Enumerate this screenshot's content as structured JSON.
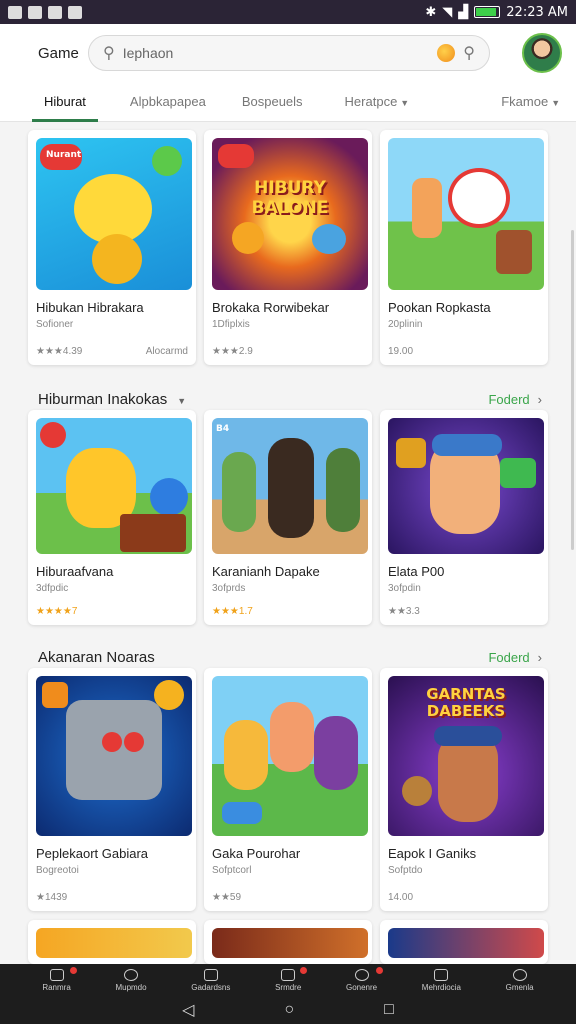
{
  "status": {
    "time": "22:23 AM",
    "battery_level": 0.9
  },
  "header": {
    "brand": "Game",
    "search_value": "Iephaon"
  },
  "tabs": [
    {
      "label": "Hiburat",
      "active": true
    },
    {
      "label": "Alpbkapapea"
    },
    {
      "label": "Bospeuels"
    },
    {
      "label": "Heratpce"
    },
    {
      "label": "Fkamoe"
    }
  ],
  "sections": [
    {
      "title": "",
      "cards": [
        {
          "title": "Hibukan Hibrakara",
          "sub": "Sofioner",
          "meta_left": "★★★4.39",
          "meta_right": "Alocarmd"
        },
        {
          "title": "Brokaka Rorwibekar",
          "sub": "1Dfiplxis",
          "meta_left": "★★★2.9",
          "meta_right": ""
        },
        {
          "title": "Pookan Ropkasta",
          "sub": "20plinin",
          "meta_left": "19.00",
          "meta_right": ""
        }
      ]
    },
    {
      "title": "Hiburman Inakokas",
      "featured": "Foderd",
      "cards": [
        {
          "title": "Hiburaafvana",
          "sub": "3dfpdic",
          "meta_left": "★★★★7",
          "meta_right": ""
        },
        {
          "title": "Karanianh Dapake",
          "sub": "3ofprds",
          "meta_left": "★★★1.7",
          "meta_right": ""
        },
        {
          "title": "Elata P00",
          "sub": "3ofpdin",
          "meta_left": "★★3.3",
          "meta_right": ""
        }
      ]
    },
    {
      "title": "Akanaran Noaras",
      "featured": "Foderd",
      "cards": [
        {
          "title": "Peplekaort Gabiara",
          "sub": "Bogreotoi",
          "meta_left": "★1439",
          "meta_right": ""
        },
        {
          "title": "Gaka Pourohar",
          "sub": "Sofptcorl",
          "meta_left": "★★59",
          "meta_right": ""
        },
        {
          "title": "Eapok I Ganiks",
          "sub": "Sofptdo",
          "meta_left": "14.00",
          "meta_right": ""
        }
      ]
    }
  ],
  "thumb_labels": {
    "badge1": "Nurant",
    "card2": "HIBURY BALONE",
    "card9": "GARNTAS DABEEKS",
    "badge4": "B4"
  },
  "bottom_nav": [
    "Ranmra",
    "Mupmdo",
    "Gadardsns",
    "Srmdre",
    "Gonenre",
    "Mehrdiocia",
    "Gmenla"
  ]
}
